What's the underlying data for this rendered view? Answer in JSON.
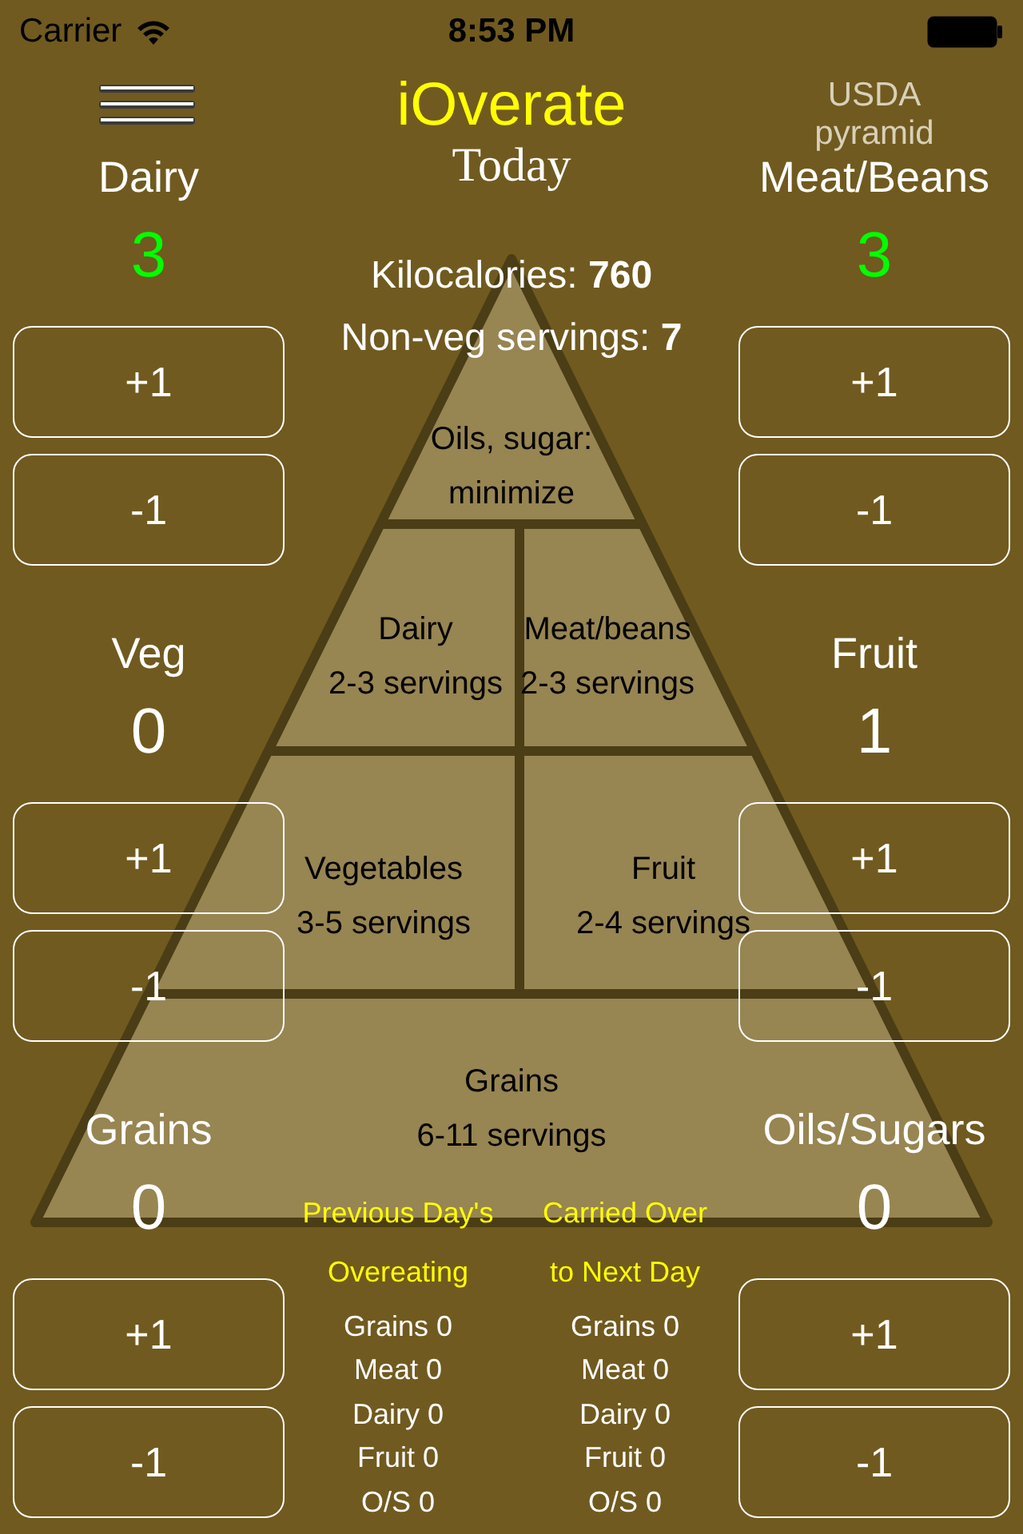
{
  "status_bar": {
    "carrier": "Carrier",
    "time": "8:53 PM"
  },
  "header": {
    "title": "iOverate",
    "subtitle": "Today",
    "link": "USDA pyramid"
  },
  "summary": [
    {
      "label": "Kilocalories:",
      "value": "760"
    },
    {
      "label": "Non-veg servings:",
      "value": "7"
    }
  ],
  "left_counters": [
    {
      "name": "Dairy",
      "count": "3",
      "on_target": true,
      "buttons": [
        "+1",
        "-1"
      ]
    },
    {
      "name": "Veg",
      "count": "0",
      "on_target": false,
      "buttons": [
        "+1",
        "-1"
      ]
    },
    {
      "name": "Grains",
      "count": "0",
      "on_target": false,
      "buttons": [
        "+1",
        "-1"
      ]
    }
  ],
  "right_counters": [
    {
      "name": "Meat/Beans",
      "count": "3",
      "on_target": true,
      "buttons": [
        "+1",
        "-1"
      ]
    },
    {
      "name": "Fruit",
      "count": "1",
      "on_target": false,
      "buttons": [
        "+1",
        "-1"
      ]
    },
    {
      "name": "Oils/Sugars",
      "count": "0",
      "on_target": false,
      "buttons": [
        "+1",
        "-1"
      ]
    }
  ],
  "pyramid": [
    {
      "name": "Oils, sugar:",
      "note": "minimize"
    },
    {
      "name": "Dairy",
      "note": "2-3 servings"
    },
    {
      "name": "Meat/beans",
      "note": "2-3 servings"
    },
    {
      "name": "Vegetables",
      "note": "3-5 servings"
    },
    {
      "name": "Fruit",
      "note": "2-4 servings"
    },
    {
      "name": "Grains",
      "note": "6-11 servings"
    }
  ],
  "carry_over": [
    {
      "title": "Previous Day's\nOvereating",
      "items": [
        "Grains 0",
        "Meat 0",
        "Dairy 0",
        "Fruit 0",
        "O/S 0"
      ]
    },
    {
      "title": "Carried Over\nto Next Day",
      "items": [
        "Grains 0",
        "Meat 0",
        "Dairy 0",
        "Fruit 0",
        "O/S 0"
      ]
    }
  ]
}
